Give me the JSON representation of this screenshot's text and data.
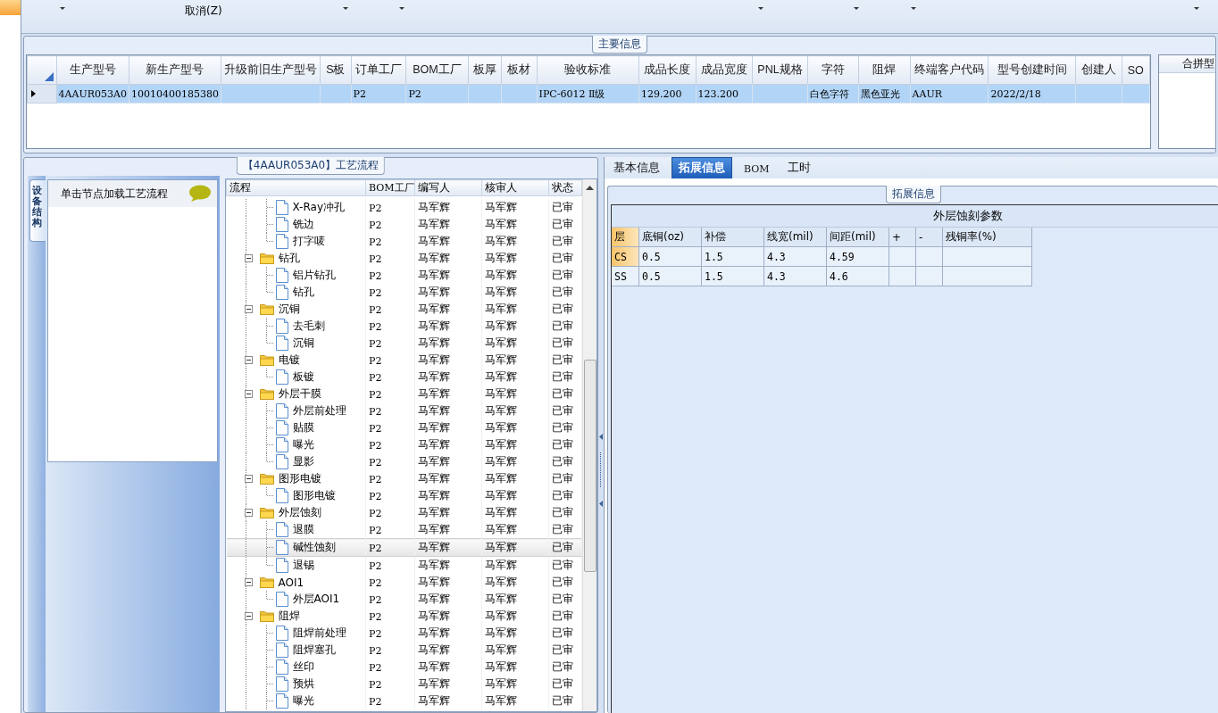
{
  "toolbar": {
    "label": "取消(Z)"
  },
  "main_info": {
    "title": "主要信息",
    "columns": [
      "生产型号",
      "新生产型号",
      "升级前旧生产型号",
      "S板",
      "订单工厂",
      "BOM工厂",
      "板厚",
      "板材",
      "验收标准",
      "成品长度",
      "成品宽度",
      "PNL规格",
      "字符",
      "阻焊",
      "终端客户代码",
      "型号创建时间",
      "创建人",
      "SO"
    ],
    "rows": [
      {
        "selected": true,
        "cells": [
          "4AAUR053A0",
          "10010400185380",
          "",
          "",
          "P2",
          "P2",
          "",
          "",
          "IPC-6012 Ⅱ级",
          "129.200",
          "123.200",
          "",
          "白色字符",
          "黑色亚光",
          "AAUR",
          "2022/2/18",
          "",
          ""
        ]
      }
    ],
    "side_panel": {
      "title": "合拼型"
    }
  },
  "process": {
    "title": "【4AAUR053A0】工艺流程",
    "side_tab": {
      "label": "设备结构",
      "selected": true
    },
    "hint": "单击节点加载工艺流程",
    "columns": [
      "流程",
      "BOM工厂",
      "编写人",
      "核审人",
      "状态"
    ],
    "nodes": [
      {
        "children": [
          {
            "label": "X-Ray冲孔",
            "bom": "P2",
            "writer": "马军辉",
            "reviewer": "马军辉",
            "status": "已审",
            "selected": false
          },
          {
            "label": "铣边",
            "bom": "P2",
            "writer": "马军辉",
            "reviewer": "马军辉",
            "status": "已审",
            "selected": false
          },
          {
            "label": "打字唛",
            "bom": "P2",
            "writer": "马军辉",
            "reviewer": "马军辉",
            "status": "已审",
            "selected": false
          }
        ]
      },
      {
        "label": "钻孔",
        "bom": "P2",
        "writer": "马军辉",
        "reviewer": "马军辉",
        "status": "已审",
        "selected": false,
        "expanded": true,
        "children": [
          {
            "label": "铝片钻孔",
            "bom": "P2",
            "writer": "马军辉",
            "reviewer": "马军辉",
            "status": "已审",
            "selected": false
          },
          {
            "label": "钻孔",
            "bom": "P2",
            "writer": "马军辉",
            "reviewer": "马军辉",
            "status": "已审",
            "selected": false
          }
        ]
      },
      {
        "label": "沉铜",
        "bom": "P2",
        "writer": "马军辉",
        "reviewer": "马军辉",
        "status": "已审",
        "selected": false,
        "expanded": true,
        "children": [
          {
            "label": "去毛刺",
            "bom": "P2",
            "writer": "马军辉",
            "reviewer": "马军辉",
            "status": "已审",
            "selected": false
          },
          {
            "label": "沉铜",
            "bom": "P2",
            "writer": "马军辉",
            "reviewer": "马军辉",
            "status": "已审",
            "selected": false
          }
        ]
      },
      {
        "label": "电镀",
        "bom": "P2",
        "writer": "马军辉",
        "reviewer": "马军辉",
        "status": "已审",
        "selected": false,
        "expanded": true,
        "children": [
          {
            "label": "板镀",
            "bom": "P2",
            "writer": "马军辉",
            "reviewer": "马军辉",
            "status": "已审",
            "selected": false
          }
        ]
      },
      {
        "label": "外层干膜",
        "bom": "P2",
        "writer": "马军辉",
        "reviewer": "马军辉",
        "status": "已审",
        "selected": false,
        "expanded": true,
        "children": [
          {
            "label": "外层前处理",
            "bom": "P2",
            "writer": "马军辉",
            "reviewer": "马军辉",
            "status": "已审",
            "selected": false
          },
          {
            "label": "贴膜",
            "bom": "P2",
            "writer": "马军辉",
            "reviewer": "马军辉",
            "status": "已审",
            "selected": false
          },
          {
            "label": "曝光",
            "bom": "P2",
            "writer": "马军辉",
            "reviewer": "马军辉",
            "status": "已审",
            "selected": false
          },
          {
            "label": "显影",
            "bom": "P2",
            "writer": "马军辉",
            "reviewer": "马军辉",
            "status": "已审",
            "selected": false
          }
        ]
      },
      {
        "label": "图形电镀",
        "bom": "P2",
        "writer": "马军辉",
        "reviewer": "马军辉",
        "status": "已审",
        "selected": false,
        "expanded": true,
        "children": [
          {
            "label": "图形电镀",
            "bom": "P2",
            "writer": "马军辉",
            "reviewer": "马军辉",
            "status": "已审",
            "selected": false
          }
        ]
      },
      {
        "label": "外层蚀刻",
        "bom": "P2",
        "writer": "马军辉",
        "reviewer": "马军辉",
        "status": "已审",
        "selected": false,
        "expanded": true,
        "children": [
          {
            "label": "退膜",
            "bom": "P2",
            "writer": "马军辉",
            "reviewer": "马军辉",
            "status": "已审",
            "selected": false
          },
          {
            "label": "碱性蚀刻",
            "bom": "P2",
            "writer": "马军辉",
            "reviewer": "马军辉",
            "status": "已审",
            "selected": true
          },
          {
            "label": "退锡",
            "bom": "P2",
            "writer": "马军辉",
            "reviewer": "马军辉",
            "status": "已审",
            "selected": false
          }
        ]
      },
      {
        "label": "AOI1",
        "bom": "P2",
        "writer": "马军辉",
        "reviewer": "马军辉",
        "status": "已审",
        "selected": false,
        "expanded": true,
        "children": [
          {
            "label": "外层AOI1",
            "bom": "P2",
            "writer": "马军辉",
            "reviewer": "马军辉",
            "status": "已审",
            "selected": false
          }
        ]
      },
      {
        "label": "阻焊",
        "bom": "P2",
        "writer": "马军辉",
        "reviewer": "马军辉",
        "status": "已审",
        "selected": false,
        "expanded": true,
        "children": [
          {
            "label": "阻焊前处理",
            "bom": "P2",
            "writer": "马军辉",
            "reviewer": "马军辉",
            "status": "已审",
            "selected": false
          },
          {
            "label": "阻焊塞孔",
            "bom": "P2",
            "writer": "马军辉",
            "reviewer": "马军辉",
            "status": "已审",
            "selected": false
          },
          {
            "label": "丝印",
            "bom": "P2",
            "writer": "马军辉",
            "reviewer": "马军辉",
            "status": "已审",
            "selected": false
          },
          {
            "label": "预烘",
            "bom": "P2",
            "writer": "马军辉",
            "reviewer": "马军辉",
            "status": "已审",
            "selected": false
          },
          {
            "label": "曝光",
            "bom": "P2",
            "writer": "马军辉",
            "reviewer": "马军辉",
            "status": "已审",
            "selected": false
          }
        ]
      }
    ]
  },
  "detail": {
    "tabs": [
      {
        "label": "基本信息",
        "selected": false
      },
      {
        "label": "拓展信息",
        "selected": true
      },
      {
        "label": "BOM",
        "selected": false
      },
      {
        "label": "工时",
        "selected": false
      }
    ],
    "group_title": "拓展信息",
    "table_title": "外层蚀刻参数",
    "columns": [
      "层",
      "底铜(oz)",
      "补偿",
      "线宽(mil)",
      "间距(mil)",
      "+",
      "-",
      "残铜率(%)"
    ],
    "rows": [
      {
        "selected": true,
        "cells": [
          "CS",
          "0.5",
          "1.5",
          "4.3",
          "4.59",
          "",
          "",
          ""
        ]
      },
      {
        "selected": false,
        "cells": [
          "SS",
          "0.5",
          "1.5",
          "4.3",
          "4.6",
          "",
          "",
          ""
        ]
      }
    ]
  }
}
